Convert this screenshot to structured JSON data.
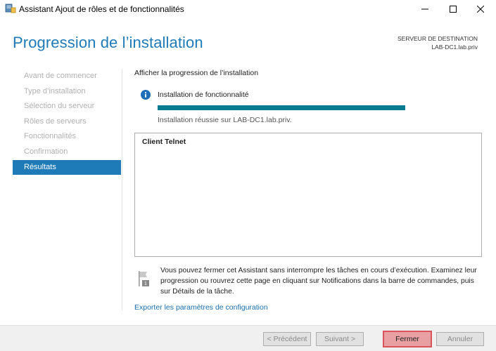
{
  "window": {
    "title": "Assistant Ajout de rôles et de fonctionnalités",
    "icons": {
      "app": "server-manager-icon",
      "minimize": "minimize-icon",
      "maximize": "maximize-icon",
      "close": "close-icon"
    }
  },
  "header": {
    "page_title": "Progression de l’installation",
    "destination_label": "SERVEUR DE DESTINATION",
    "destination_server": "LAB-DC1.lab.priv"
  },
  "sidebar": {
    "items": [
      {
        "label": "Avant de commencer",
        "active": false
      },
      {
        "label": "Type d’installation",
        "active": false
      },
      {
        "label": "Sélection du serveur",
        "active": false
      },
      {
        "label": "Rôles de serveurs",
        "active": false
      },
      {
        "label": "Fonctionnalités",
        "active": false
      },
      {
        "label": "Confirmation",
        "active": false
      },
      {
        "label": "Résultats",
        "active": true
      }
    ]
  },
  "main": {
    "progress_heading": "Afficher la progression de l’installation",
    "install_title": "Installation de fonctionnalité",
    "progress_fraction": 1.0,
    "install_status": "Installation réussie sur LAB-DC1.lab.priv.",
    "results": [
      "Client Telnet"
    ],
    "note": "Vous pouvez fermer cet Assistant sans interrompre les tâches en cours d’exécution. Examinez leur progression ou rouvrez cette page en cliquant sur Notifications dans la barre de commandes, puis sur Détails de la tâche.",
    "export_link": "Exporter les paramètres de configuration"
  },
  "footer": {
    "prev_label": "< Précédent",
    "next_label": "Suivant >",
    "close_label": "Fermer",
    "cancel_label": "Annuler"
  },
  "colors": {
    "accent": "#1e7bb8",
    "progress": "#0a7a90",
    "close_button_bg": "#e9a0a2",
    "close_button_border": "#d9535a"
  }
}
